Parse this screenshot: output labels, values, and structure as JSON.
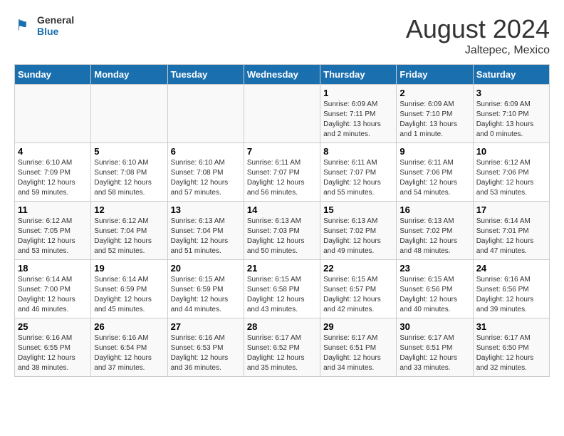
{
  "header": {
    "logo_general": "General",
    "logo_blue": "Blue",
    "title": "August 2024",
    "subtitle": "Jaltepec, Mexico"
  },
  "days_of_week": [
    "Sunday",
    "Monday",
    "Tuesday",
    "Wednesday",
    "Thursday",
    "Friday",
    "Saturday"
  ],
  "weeks": [
    [
      {
        "day": "",
        "info": ""
      },
      {
        "day": "",
        "info": ""
      },
      {
        "day": "",
        "info": ""
      },
      {
        "day": "",
        "info": ""
      },
      {
        "day": "1",
        "info": "Sunrise: 6:09 AM\nSunset: 7:11 PM\nDaylight: 13 hours\nand 2 minutes."
      },
      {
        "day": "2",
        "info": "Sunrise: 6:09 AM\nSunset: 7:10 PM\nDaylight: 13 hours\nand 1 minute."
      },
      {
        "day": "3",
        "info": "Sunrise: 6:09 AM\nSunset: 7:10 PM\nDaylight: 13 hours\nand 0 minutes."
      }
    ],
    [
      {
        "day": "4",
        "info": "Sunrise: 6:10 AM\nSunset: 7:09 PM\nDaylight: 12 hours\nand 59 minutes."
      },
      {
        "day": "5",
        "info": "Sunrise: 6:10 AM\nSunset: 7:08 PM\nDaylight: 12 hours\nand 58 minutes."
      },
      {
        "day": "6",
        "info": "Sunrise: 6:10 AM\nSunset: 7:08 PM\nDaylight: 12 hours\nand 57 minutes."
      },
      {
        "day": "7",
        "info": "Sunrise: 6:11 AM\nSunset: 7:07 PM\nDaylight: 12 hours\nand 56 minutes."
      },
      {
        "day": "8",
        "info": "Sunrise: 6:11 AM\nSunset: 7:07 PM\nDaylight: 12 hours\nand 55 minutes."
      },
      {
        "day": "9",
        "info": "Sunrise: 6:11 AM\nSunset: 7:06 PM\nDaylight: 12 hours\nand 54 minutes."
      },
      {
        "day": "10",
        "info": "Sunrise: 6:12 AM\nSunset: 7:06 PM\nDaylight: 12 hours\nand 53 minutes."
      }
    ],
    [
      {
        "day": "11",
        "info": "Sunrise: 6:12 AM\nSunset: 7:05 PM\nDaylight: 12 hours\nand 53 minutes."
      },
      {
        "day": "12",
        "info": "Sunrise: 6:12 AM\nSunset: 7:04 PM\nDaylight: 12 hours\nand 52 minutes."
      },
      {
        "day": "13",
        "info": "Sunrise: 6:13 AM\nSunset: 7:04 PM\nDaylight: 12 hours\nand 51 minutes."
      },
      {
        "day": "14",
        "info": "Sunrise: 6:13 AM\nSunset: 7:03 PM\nDaylight: 12 hours\nand 50 minutes."
      },
      {
        "day": "15",
        "info": "Sunrise: 6:13 AM\nSunset: 7:02 PM\nDaylight: 12 hours\nand 49 minutes."
      },
      {
        "day": "16",
        "info": "Sunrise: 6:13 AM\nSunset: 7:02 PM\nDaylight: 12 hours\nand 48 minutes."
      },
      {
        "day": "17",
        "info": "Sunrise: 6:14 AM\nSunset: 7:01 PM\nDaylight: 12 hours\nand 47 minutes."
      }
    ],
    [
      {
        "day": "18",
        "info": "Sunrise: 6:14 AM\nSunset: 7:00 PM\nDaylight: 12 hours\nand 46 minutes."
      },
      {
        "day": "19",
        "info": "Sunrise: 6:14 AM\nSunset: 6:59 PM\nDaylight: 12 hours\nand 45 minutes."
      },
      {
        "day": "20",
        "info": "Sunrise: 6:15 AM\nSunset: 6:59 PM\nDaylight: 12 hours\nand 44 minutes."
      },
      {
        "day": "21",
        "info": "Sunrise: 6:15 AM\nSunset: 6:58 PM\nDaylight: 12 hours\nand 43 minutes."
      },
      {
        "day": "22",
        "info": "Sunrise: 6:15 AM\nSunset: 6:57 PM\nDaylight: 12 hours\nand 42 minutes."
      },
      {
        "day": "23",
        "info": "Sunrise: 6:15 AM\nSunset: 6:56 PM\nDaylight: 12 hours\nand 40 minutes."
      },
      {
        "day": "24",
        "info": "Sunrise: 6:16 AM\nSunset: 6:56 PM\nDaylight: 12 hours\nand 39 minutes."
      }
    ],
    [
      {
        "day": "25",
        "info": "Sunrise: 6:16 AM\nSunset: 6:55 PM\nDaylight: 12 hours\nand 38 minutes."
      },
      {
        "day": "26",
        "info": "Sunrise: 6:16 AM\nSunset: 6:54 PM\nDaylight: 12 hours\nand 37 minutes."
      },
      {
        "day": "27",
        "info": "Sunrise: 6:16 AM\nSunset: 6:53 PM\nDaylight: 12 hours\nand 36 minutes."
      },
      {
        "day": "28",
        "info": "Sunrise: 6:17 AM\nSunset: 6:52 PM\nDaylight: 12 hours\nand 35 minutes."
      },
      {
        "day": "29",
        "info": "Sunrise: 6:17 AM\nSunset: 6:51 PM\nDaylight: 12 hours\nand 34 minutes."
      },
      {
        "day": "30",
        "info": "Sunrise: 6:17 AM\nSunset: 6:51 PM\nDaylight: 12 hours\nand 33 minutes."
      },
      {
        "day": "31",
        "info": "Sunrise: 6:17 AM\nSunset: 6:50 PM\nDaylight: 12 hours\nand 32 minutes."
      }
    ]
  ]
}
